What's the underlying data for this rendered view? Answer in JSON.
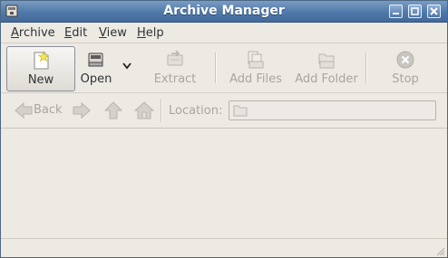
{
  "window": {
    "title": "Archive Manager"
  },
  "menubar": {
    "items": [
      {
        "label": "Archive",
        "mnemonic": "A",
        "rest": "rchive"
      },
      {
        "label": "Edit",
        "mnemonic": "E",
        "rest": "dit"
      },
      {
        "label": "View",
        "mnemonic": "V",
        "rest": "iew"
      },
      {
        "label": "Help",
        "mnemonic": "H",
        "rest": "elp"
      }
    ]
  },
  "toolbar": {
    "new_label": "New",
    "open_label": "Open",
    "extract_label": "Extract",
    "add_files_label": "Add Files",
    "add_folder_label": "Add Folder",
    "stop_label": "Stop"
  },
  "locationbar": {
    "back_label": "Back",
    "location_label": "Location:",
    "location_value": ""
  },
  "icons": {
    "app": "archive-manager-icon",
    "minimize": "minimize-icon",
    "maximize": "maximize-icon",
    "close": "close-icon",
    "new": "new-archive-icon",
    "open": "open-archive-icon",
    "dropdown": "chevron-down-icon",
    "extract": "extract-icon",
    "add_files": "add-files-icon",
    "add_folder": "add-folder-icon",
    "stop": "stop-icon",
    "back": "back-arrow-icon",
    "forward": "forward-arrow-icon",
    "up": "up-arrow-icon",
    "home": "home-icon",
    "folder": "folder-icon"
  },
  "colors": {
    "titlebar": "#4f79aa",
    "background": "#ede9e3",
    "disabled_text": "#a9a6a0"
  }
}
